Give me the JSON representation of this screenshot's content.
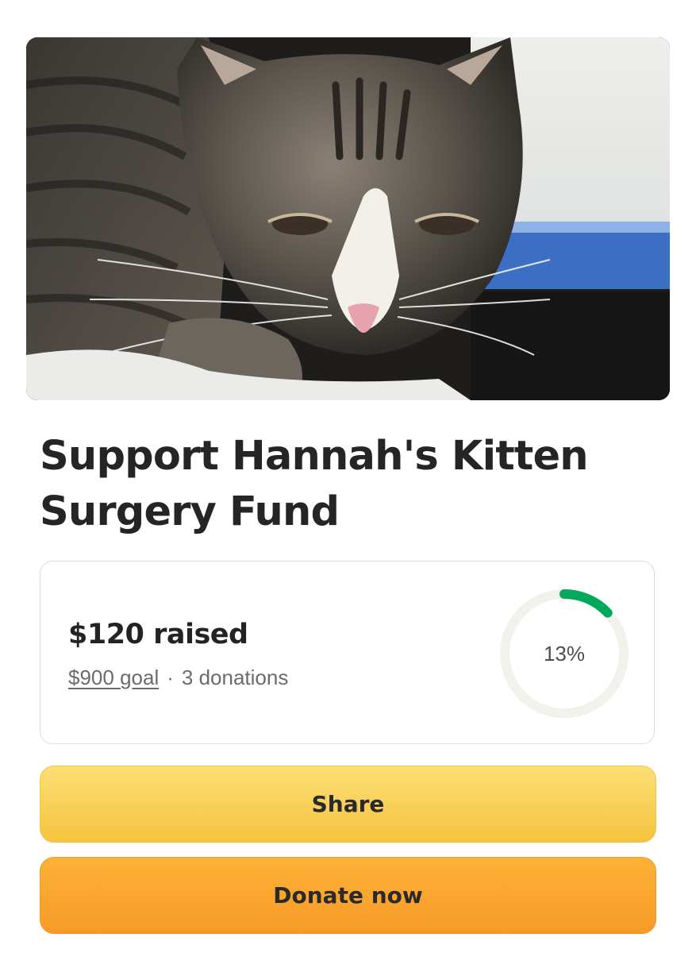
{
  "campaign": {
    "title": "Support Hannah's Kitten Surgery Fund",
    "hero_image": "tabby-kitten-photo"
  },
  "progress": {
    "raised_text": "$120 raised",
    "goal_text": "$900 goal",
    "separator": "·",
    "donations_text": "3 donations",
    "percent_text": "13%",
    "percent_value": 13,
    "ring_color": "#02a95c",
    "track_color": "#f2f1ec"
  },
  "actions": {
    "share_label": "Share",
    "donate_label": "Donate now"
  }
}
